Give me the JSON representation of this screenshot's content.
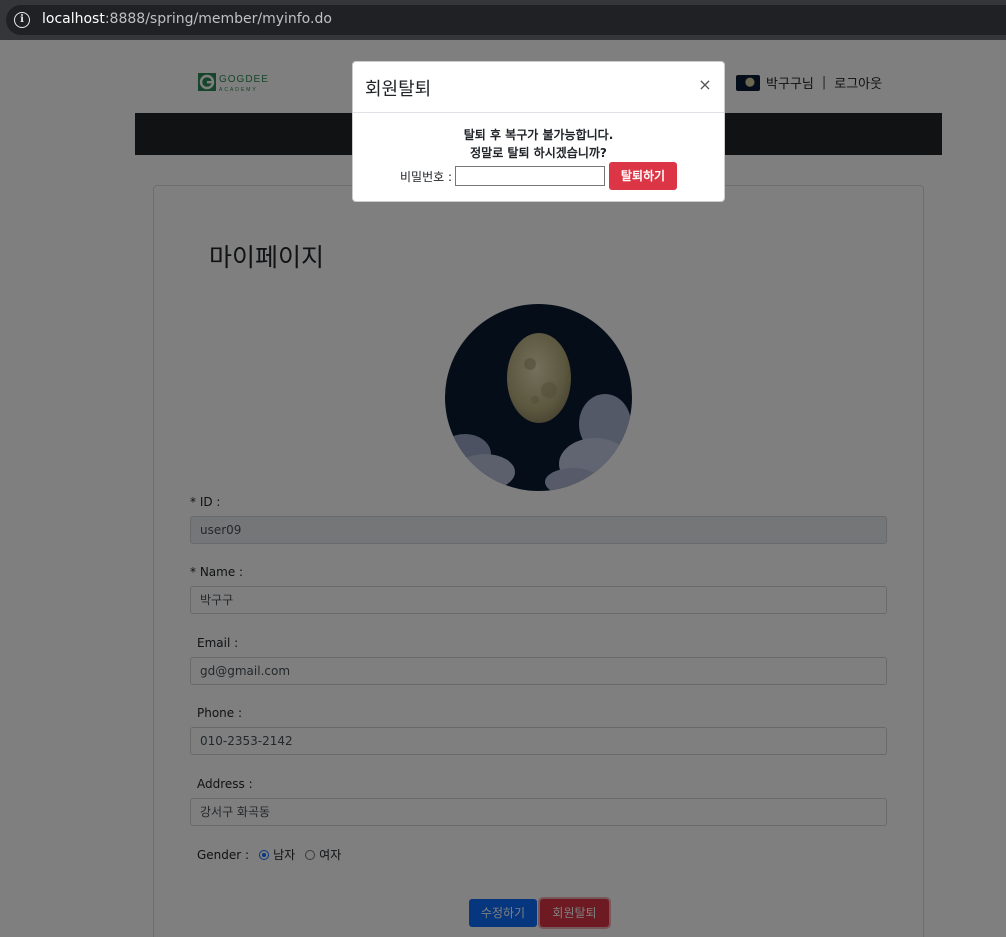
{
  "browser": {
    "url_host": "localhost",
    "url_rest": ":8888/spring/member/myinfo.do"
  },
  "header": {
    "logo_text": "GOGDEE",
    "logo_sub": "ACADEMY",
    "user_name": "박구구님",
    "separator": "|",
    "logout_label": "로그아웃"
  },
  "main": {
    "title": "마이페이지",
    "fields": [
      {
        "label": "* ID :",
        "value": "user09"
      },
      {
        "label": "* Name :",
        "value": "박구구"
      },
      {
        "label": "Email :",
        "value": "gd@gmail.com"
      },
      {
        "label": "Phone :",
        "value": "010-2353-2142"
      },
      {
        "label": "Address :",
        "value": "강서구 화곡동"
      }
    ],
    "gender": {
      "label": "Gender :",
      "options": [
        "남자",
        "여자"
      ],
      "selected": "남자"
    },
    "edit_button": "수정하기",
    "withdraw_button": "회원탈퇴"
  },
  "modal": {
    "title": "회원탈퇴",
    "close": "×",
    "message_line1": "탈퇴 후 복구가 불가능합니다.",
    "message_line2": "정말로 탈퇴 하시겠습니까?",
    "password_label": "비밀번호 :",
    "password_value": "",
    "submit_label": "탈퇴하기"
  },
  "colors": {
    "primary": "#0d6efd",
    "danger": "#dc3545",
    "navbar": "#212529"
  }
}
